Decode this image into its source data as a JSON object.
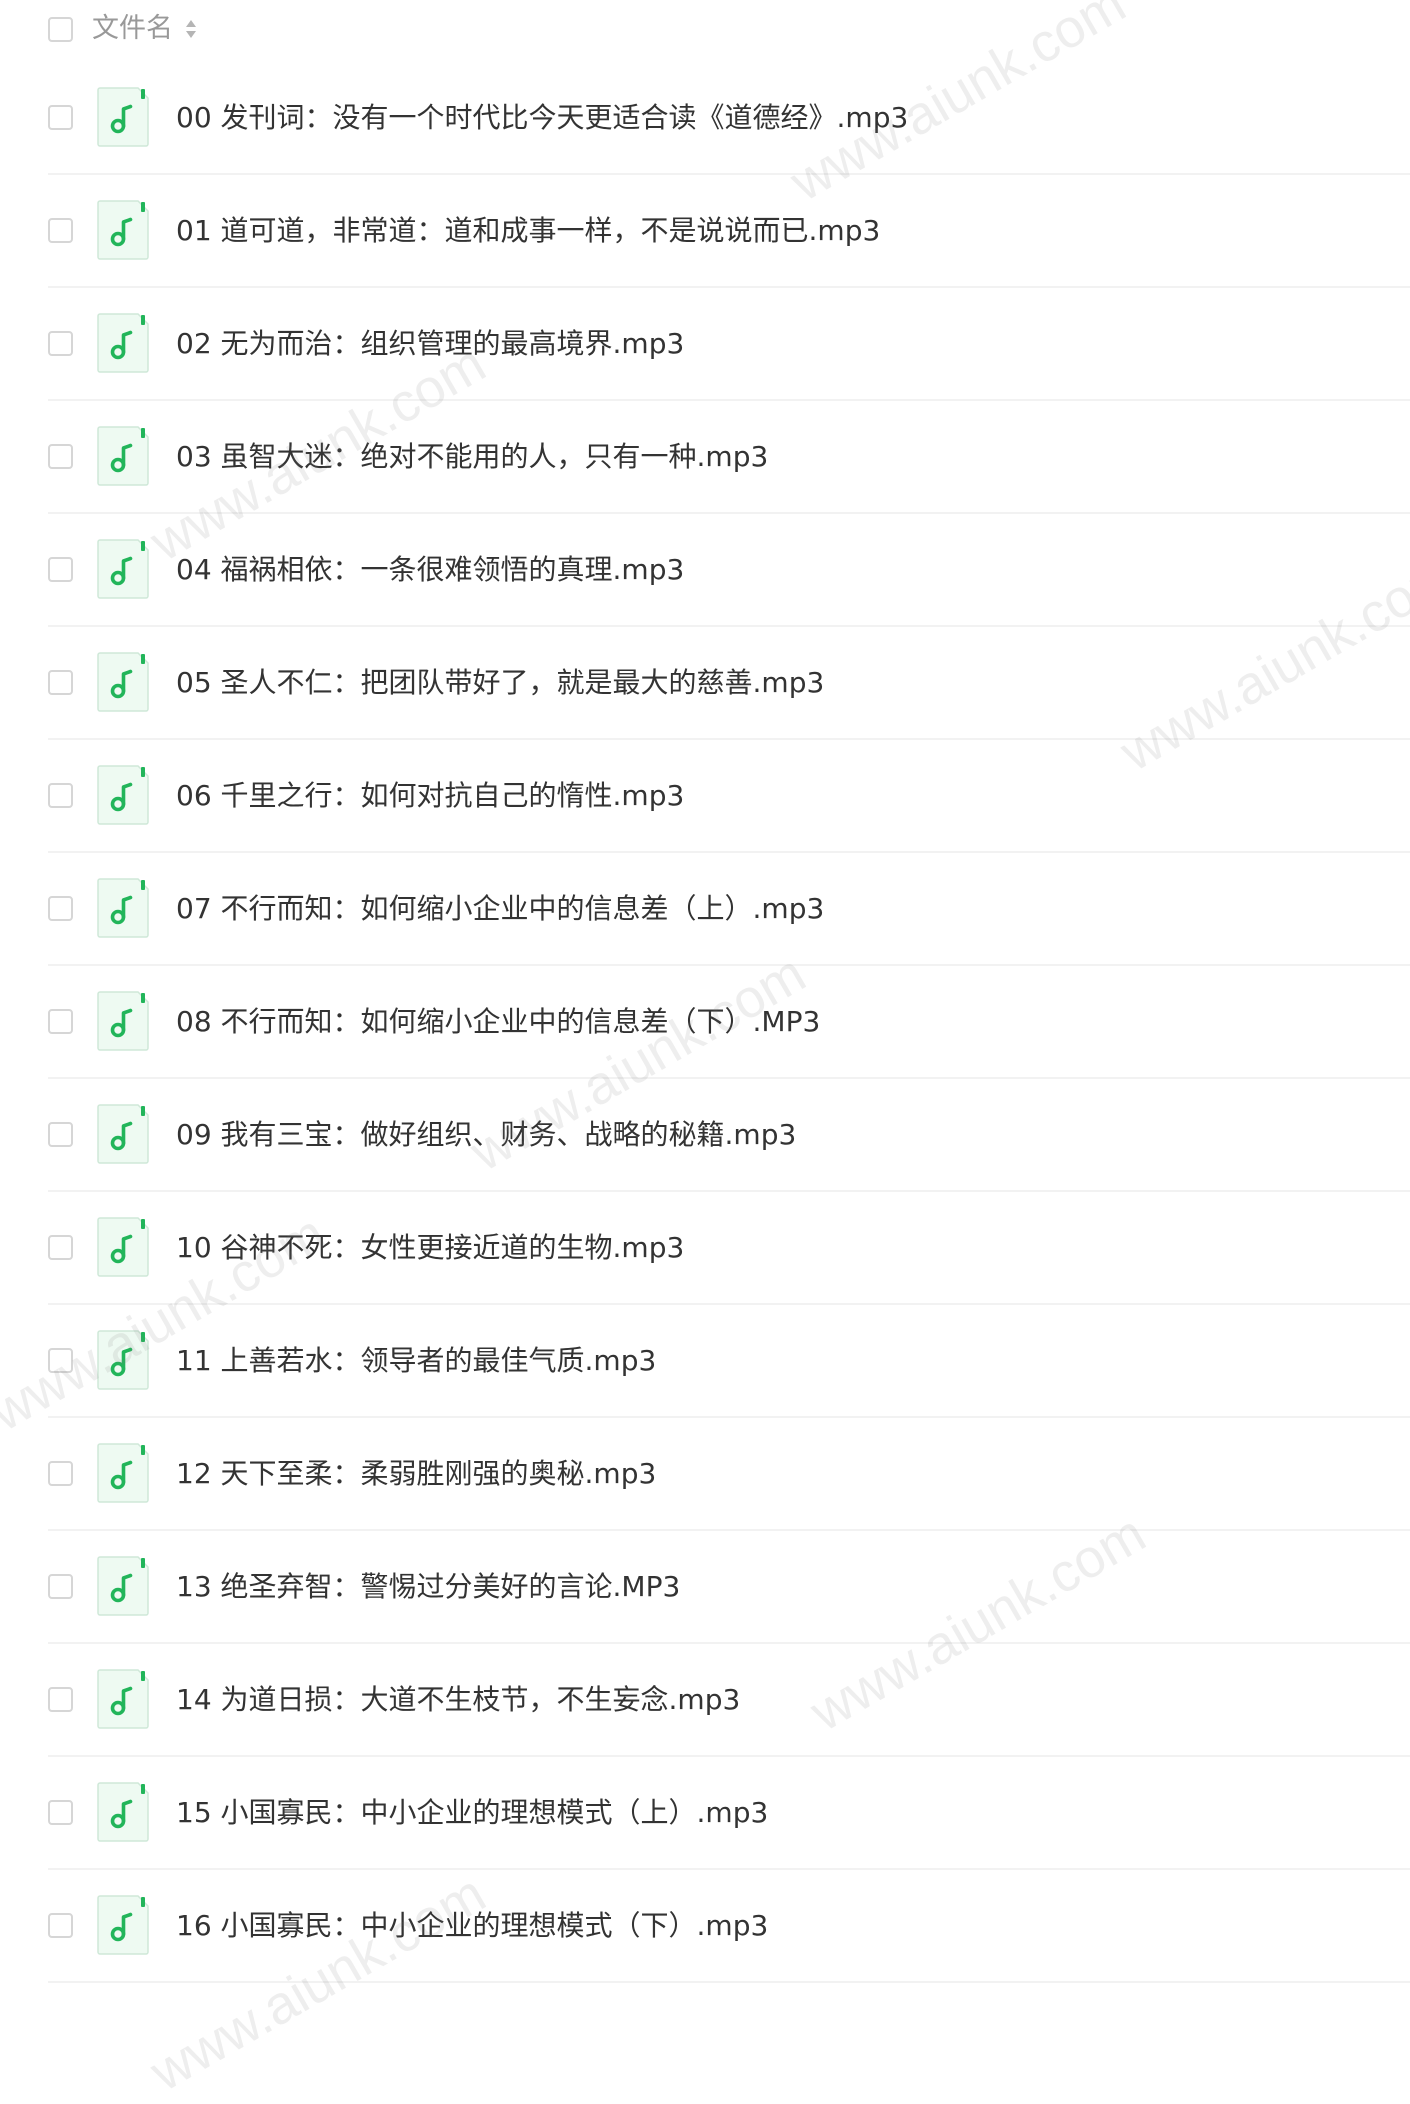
{
  "header": {
    "column_label": "文件名"
  },
  "icons": {
    "audio_file": "music-note-icon",
    "sort": "sort-icon"
  },
  "colors": {
    "accent_green": "#22b55a",
    "icon_bg": "#eefaf2",
    "divider": "#f2f2f2"
  },
  "files": [
    {
      "name": "00 发刊词：没有一个时代比今天更适合读《道德经》.mp3"
    },
    {
      "name": "01 道可道，非常道：道和成事一样，不是说说而已.mp3"
    },
    {
      "name": "02 无为而治：组织管理的最高境界.mp3"
    },
    {
      "name": "03 虽智大迷：绝对不能用的人，只有一种.mp3"
    },
    {
      "name": "04 福祸相依：一条很难领悟的真理.mp3"
    },
    {
      "name": "05 圣人不仁：把团队带好了，就是最大的慈善.mp3"
    },
    {
      "name": "06 千里之行：如何对抗自己的惰性.mp3"
    },
    {
      "name": "07 不行而知：如何缩小企业中的信息差（上）.mp3"
    },
    {
      "name": "08 不行而知：如何缩小企业中的信息差（下）.MP3"
    },
    {
      "name": "09 我有三宝：做好组织、财务、战略的秘籍.mp3"
    },
    {
      "name": "10 谷神不死：女性更接近道的生物.mp3"
    },
    {
      "name": "11 上善若水：领导者的最佳气质.mp3"
    },
    {
      "name": "12 天下至柔：柔弱胜刚强的奥秘.mp3"
    },
    {
      "name": "13 绝圣弃智：警惕过分美好的言论.MP3"
    },
    {
      "name": "14 为道日损：大道不生枝节，不生妄念.mp3"
    },
    {
      "name": "15 小国寡民：中小企业的理想模式（上）.mp3"
    },
    {
      "name": "16 小国寡民：中小企业的理想模式（下）.mp3"
    }
  ],
  "watermarks": [
    {
      "text": "www.aiunk.com"
    },
    {
      "text": "www.aiunk.com"
    },
    {
      "text": "www.aiunk.com"
    },
    {
      "text": "www.aiunk.com"
    },
    {
      "text": "www.aiunk.com"
    },
    {
      "text": "www.aiunk.com"
    },
    {
      "text": "www.aiunk.com"
    }
  ]
}
